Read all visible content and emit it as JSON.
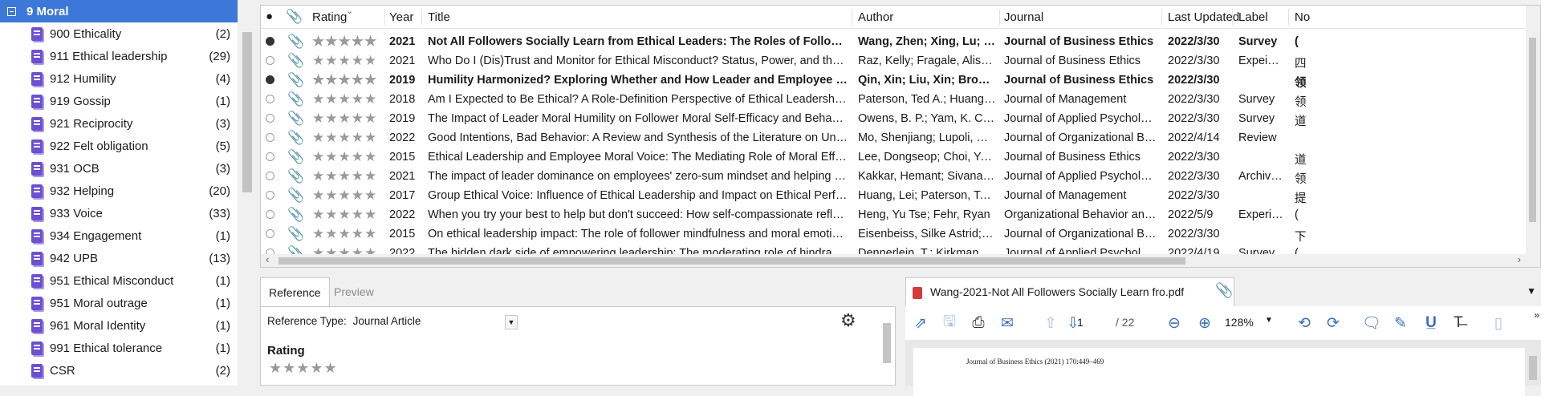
{
  "tree": {
    "parent": "9 Moral",
    "groups": [
      {
        "name": "900 Ethicality",
        "count": "(2)"
      },
      {
        "name": "911 Ethical leadership",
        "count": "(29)"
      },
      {
        "name": "912 Humility",
        "count": "(4)"
      },
      {
        "name": "919 Gossip",
        "count": "(1)"
      },
      {
        "name": "921 Reciprocity",
        "count": "(3)"
      },
      {
        "name": "922 Felt obligation",
        "count": "(5)"
      },
      {
        "name": "931 OCB",
        "count": "(3)"
      },
      {
        "name": "932 Helping",
        "count": "(20)"
      },
      {
        "name": "933 Voice",
        "count": "(33)"
      },
      {
        "name": "934 Engagement",
        "count": "(1)"
      },
      {
        "name": "942 UPB",
        "count": "(13)"
      },
      {
        "name": "951 Ethical Misconduct",
        "count": "(1)"
      },
      {
        "name": "951 Moral outrage",
        "count": "(1)"
      },
      {
        "name": "961 Moral Identity",
        "count": "(1)"
      },
      {
        "name": "991 Ethical tolerance",
        "count": "(1)"
      },
      {
        "name": "CSR",
        "count": "(2)"
      }
    ]
  },
  "columns": {
    "rating": "Rating",
    "year": "Year",
    "title": "Title",
    "author": "Author",
    "journal": "Journal",
    "updated": "Last Updated",
    "label": "Label",
    "notes": "No"
  },
  "references": [
    {
      "read": true,
      "bold": true,
      "year": "2021",
      "title": "Not All Followers Socially Learn from Ethical Leaders: The Roles of Followers' Moral Identi...",
      "author": "Wang, Zhen; Xing, Lu; Xu, H...",
      "journal": "Journal of Business Ethics",
      "updated": "2022/3/30",
      "label": "Survey",
      "notes": "("
    },
    {
      "read": false,
      "bold": false,
      "year": "2021",
      "title": "Who Do I (Dis)Trust and Monitor for Ethical Misconduct? Status, Power, and the Structural Parad...",
      "author": "Raz, Kelly; Fragale, Alison R.; L...",
      "journal": "Journal of Business Ethics",
      "updated": "2022/3/30",
      "label": "Expeime...",
      "notes": "四"
    },
    {
      "read": true,
      "bold": true,
      "year": "2019",
      "title": "Humility Harmonized? Exploring Whether and How Leader and Employee Humility (In)Co...",
      "author": "Qin, Xin; Liu, Xin; Brown, Jac...",
      "journal": "Journal of Business Ethics",
      "updated": "2022/3/30",
      "label": "",
      "notes": "领"
    },
    {
      "read": false,
      "bold": false,
      "year": "2018",
      "title": "Am I Expected to Be Ethical? A Role-Definition Perspective of Ethical Leadership and Unethical ...",
      "author": "Paterson, Ted A.; Huang, Lei",
      "journal": "Journal of Management",
      "updated": "2022/3/30",
      "label": "Survey",
      "notes": "领"
    },
    {
      "read": false,
      "bold": false,
      "year": "2019",
      "title": "The Impact of Leader Moral Humility on Follower Moral Self-Efficacy and Behavior",
      "author": "Owens, B. P.; Yam, K. C.; Bednar...",
      "journal": "Journal of Applied Psychology",
      "updated": "2022/3/30",
      "label": "Survey",
      "notes": "道"
    },
    {
      "read": false,
      "bold": false,
      "year": "2022",
      "title": "Good Intentions, Bad Behavior: A Review and Synthesis of the Literature on Unethical Prosocial ...",
      "author": "Mo, Shenjiang; Lupoli, Matthe...",
      "journal": "Journal of Organizational Behavior",
      "updated": "2022/4/14",
      "label": "Review",
      "notes": ""
    },
    {
      "read": false,
      "bold": false,
      "year": "2015",
      "title": "Ethical Leadership and Employee Moral Voice: The Mediating Role of Moral Efficacy and the M...",
      "author": "Lee, Dongseop; Choi, Yongduk...",
      "journal": "Journal of Business Ethics",
      "updated": "2022/3/30",
      "label": "",
      "notes": "道"
    },
    {
      "read": false,
      "bold": false,
      "year": "2021",
      "title": "The impact of leader dominance on employees' zero-sum mindset and helping behavior",
      "author": "Kakkar, Hemant; Sivanathan, N...",
      "journal": "Journal of Applied Psychology",
      "updated": "2022/3/30",
      "label": "Archival...",
      "notes": "领"
    },
    {
      "read": false,
      "bold": false,
      "year": "2017",
      "title": "Group Ethical Voice: Influence of Ethical Leadership and Impact on Ethical Performance",
      "author": "Huang, Lei; Paterson, Ted A.",
      "journal": "Journal of Management",
      "updated": "2022/3/30",
      "label": "",
      "notes": "提"
    },
    {
      "read": false,
      "bold": false,
      "year": "2022",
      "title": "When you try your best to help but don't succeed: How self-compassionate reflection influences...",
      "author": "Heng, Yu Tse; Fehr, Ryan",
      "journal": "Organizational Behavior and Hum...",
      "updated": "2022/5/9",
      "label": "Experime...",
      "notes": "("
    },
    {
      "read": false,
      "bold": false,
      "year": "2015",
      "title": "On ethical leadership impact: The role of follower mindfulness and moral emotions",
      "author": "Eisenbeiss, Silke Astrid; van Kn...",
      "journal": "Journal of Organizational Behavior",
      "updated": "2022/3/30",
      "label": "",
      "notes": "下"
    },
    {
      "read": false,
      "bold": false,
      "year": "2022",
      "title": "The hidden dark side of empowering leadership: The moderating role of hindrance stressors in ...",
      "author": "Dennerlein, T.; Kirkman, B. L.",
      "journal": "Journal of Applied Psychology",
      "updated": "2022/4/19",
      "label": "Survey: E...",
      "notes": "("
    }
  ],
  "tabs": {
    "reference": "Reference",
    "preview": "Preview"
  },
  "refpanel": {
    "type_label": "Reference Type:",
    "type_value": "Journal Article",
    "rating_label": "Rating"
  },
  "pdf": {
    "tab_title": "Wang-2021-Not All Followers Socially Learn fro.pdf",
    "page": "1",
    "total": "/ 22",
    "zoom": "128%",
    "header_text": "Journal of Business Ethics (2021) 170:449–469"
  }
}
